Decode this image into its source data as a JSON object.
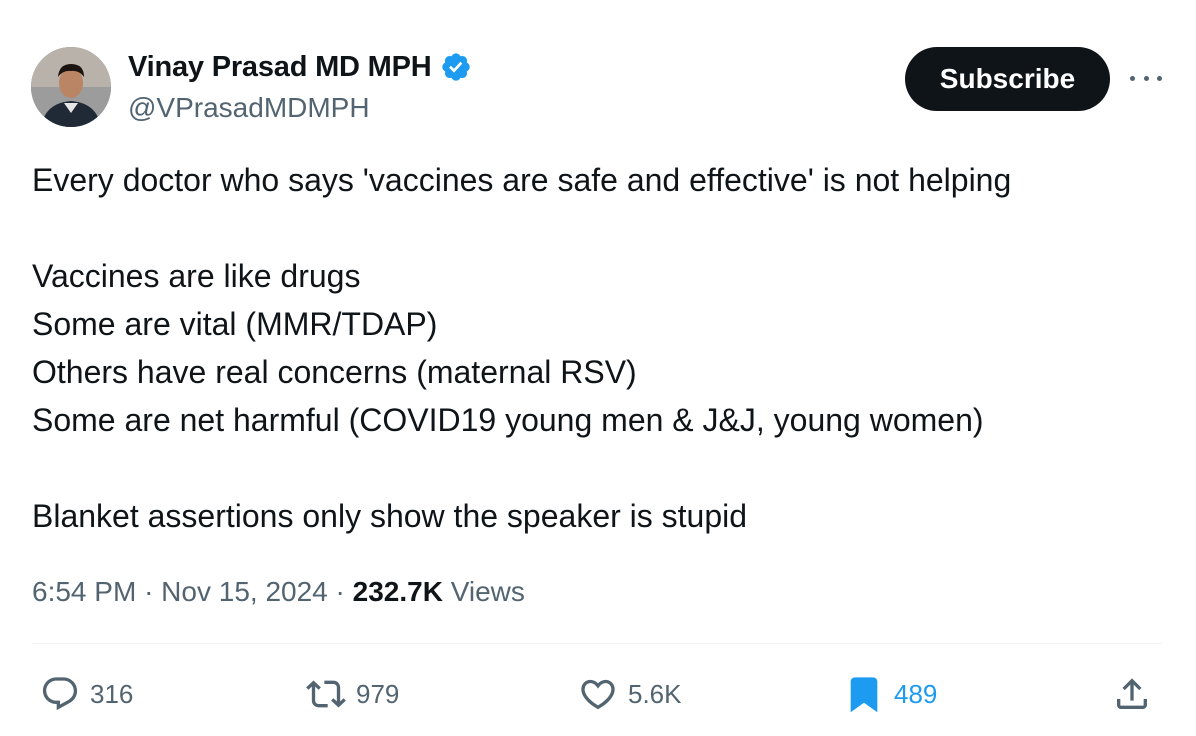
{
  "author": {
    "display_name": "Vinay Prasad MD MPH",
    "handle": "@VPrasadMDMPH",
    "verified": true,
    "verified_color": "#1d9bf0"
  },
  "header": {
    "subscribe_label": "Subscribe",
    "more_icon": "more-horizontal-icon"
  },
  "tweet": {
    "lines": [
      "Every doctor who says 'vaccines are safe and effective' is not helping",
      "",
      "Vaccines are like drugs",
      "Some are vital (MMR/TDAP)",
      "Others have real concerns (maternal RSV)",
      "Some are net harmful (COVID19 young men & J&J, young women)",
      "",
      "Blanket assertions only show the speaker is stupid"
    ]
  },
  "meta": {
    "time": "6:54 PM",
    "separator": "·",
    "date": "Nov 15, 2024",
    "views_count": "232.7K",
    "views_label": "Views"
  },
  "actions": {
    "replies": {
      "icon": "reply-icon",
      "count": "316"
    },
    "reposts": {
      "icon": "repost-icon",
      "count": "979"
    },
    "likes": {
      "icon": "heart-icon",
      "count": "5.6K"
    },
    "bookmarks": {
      "icon": "bookmark-icon",
      "count": "489",
      "active_color": "#1d9bf0"
    },
    "share": {
      "icon": "share-icon"
    }
  },
  "colors": {
    "text_primary": "#0f1419",
    "text_secondary": "#536471",
    "accent": "#1d9bf0",
    "button_dark": "#0f1419"
  }
}
